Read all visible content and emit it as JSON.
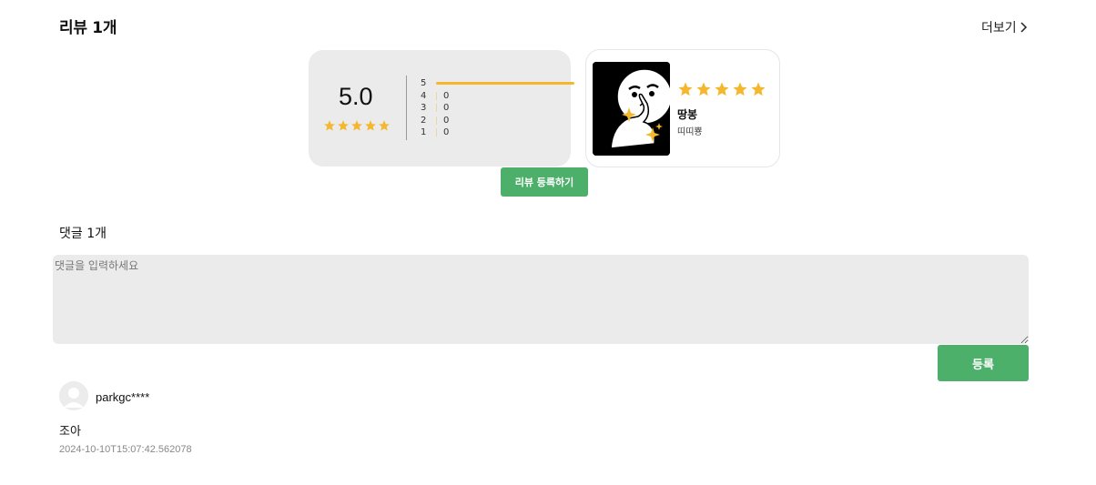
{
  "reviews": {
    "title": "리뷰 1개",
    "more_label": "더보기",
    "average_score": "5.0",
    "average_stars": 5,
    "distribution": [
      {
        "star": "5",
        "count": "",
        "fraction": 1.0
      },
      {
        "star": "4",
        "count": "0",
        "fraction": 0
      },
      {
        "star": "3",
        "count": "0",
        "fraction": 0
      },
      {
        "star": "2",
        "count": "0",
        "fraction": 0
      },
      {
        "star": "1",
        "count": "0",
        "fraction": 0
      }
    ],
    "latest": {
      "rating": 5,
      "title": "땅봉",
      "subtitle": "띠띠뿅"
    },
    "write_button_label": "리뷰 등록하기"
  },
  "comments": {
    "title": "댓글 1개",
    "input_placeholder": "댓글을 입력하세요",
    "submit_label": "등록",
    "items": [
      {
        "username": "parkgc****",
        "text": "조아",
        "timestamp": "2024-10-10T15:07:42.562078"
      }
    ]
  },
  "colors": {
    "accent_green": "#4caf6a",
    "star_yellow": "#f5b72d",
    "card_gray": "#ebebeb"
  },
  "icons": {
    "more": "chevron-right-icon",
    "star": "star-icon",
    "avatar": "user-avatar-icon"
  }
}
